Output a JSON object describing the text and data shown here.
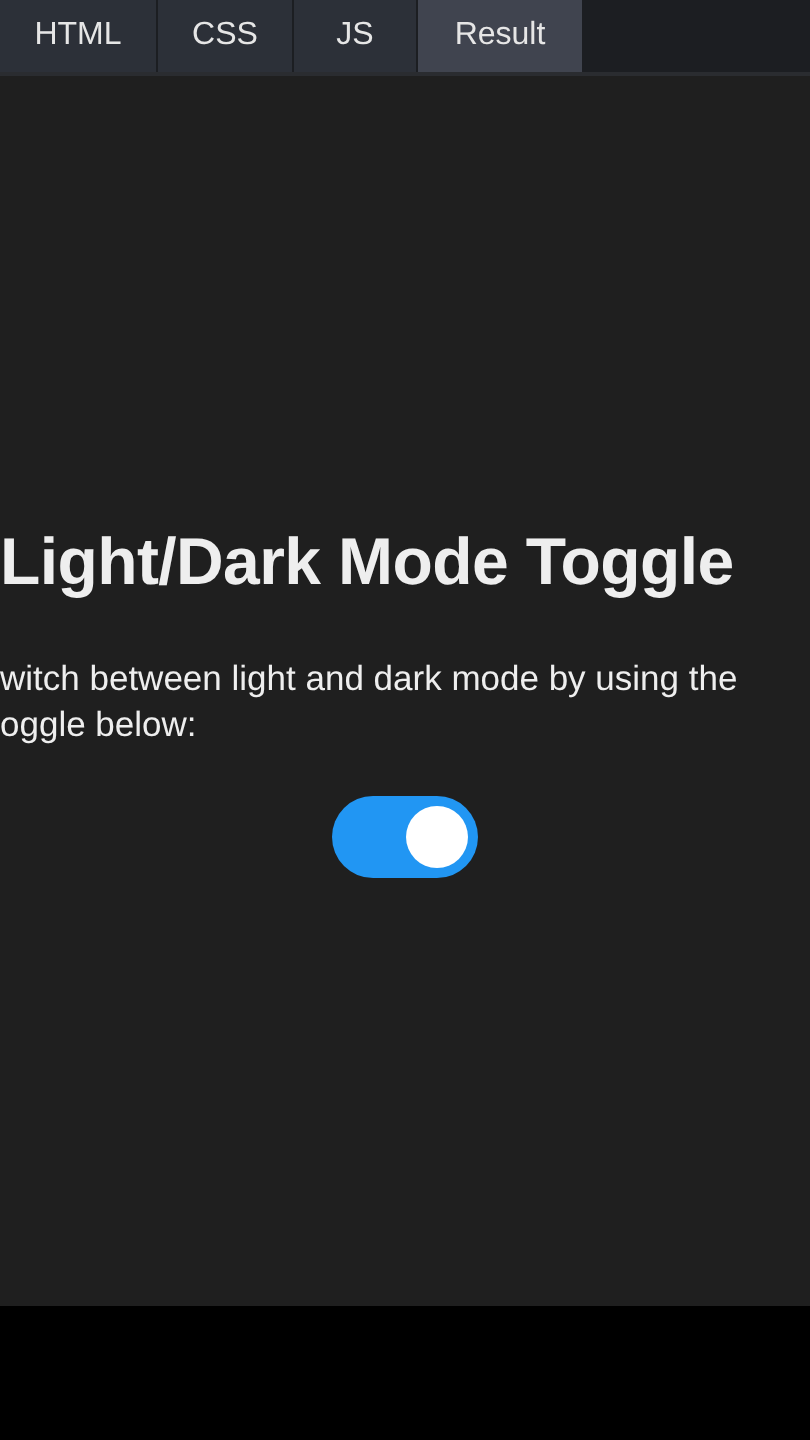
{
  "tabs": [
    {
      "label": "HTML",
      "selected": false
    },
    {
      "label": "CSS",
      "selected": false
    },
    {
      "label": "JS",
      "selected": false
    },
    {
      "label": "Result",
      "selected": true
    }
  ],
  "result": {
    "title": "Light/Dark Mode Toggle",
    "description_lines": [
      "witch between light and dark mode by using the",
      "oggle below:"
    ],
    "toggle": {
      "on": true
    }
  }
}
